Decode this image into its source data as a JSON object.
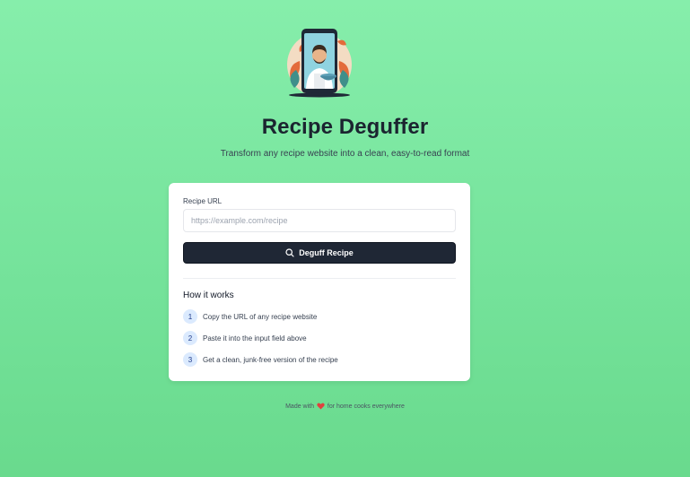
{
  "header": {
    "logo_icon": "chef-on-phone-logo",
    "title": "Recipe Deguffer",
    "subtitle": "Transform any recipe website into a clean, easy-to-read format"
  },
  "form": {
    "label": "Recipe URL",
    "input_value": "",
    "placeholder": "https://example.com/recipe",
    "button_icon": "search-icon",
    "button_label": "Deguff Recipe"
  },
  "how_it_works": {
    "title": "How it works",
    "steps": [
      {
        "number": "1",
        "text": "Copy the URL of any recipe website"
      },
      {
        "number": "2",
        "text": "Paste it into the input field above"
      },
      {
        "number": "3",
        "text": "Get a clean, junk-free version of the recipe"
      }
    ]
  },
  "footer": {
    "prefix": "Made with",
    "icon": "heart-icon",
    "suffix": "for home cooks everywhere"
  },
  "colors": {
    "background": "#7de8a4",
    "button": "#1f2735",
    "step_badge": "#dbeafe",
    "heart": "#e0413f"
  }
}
